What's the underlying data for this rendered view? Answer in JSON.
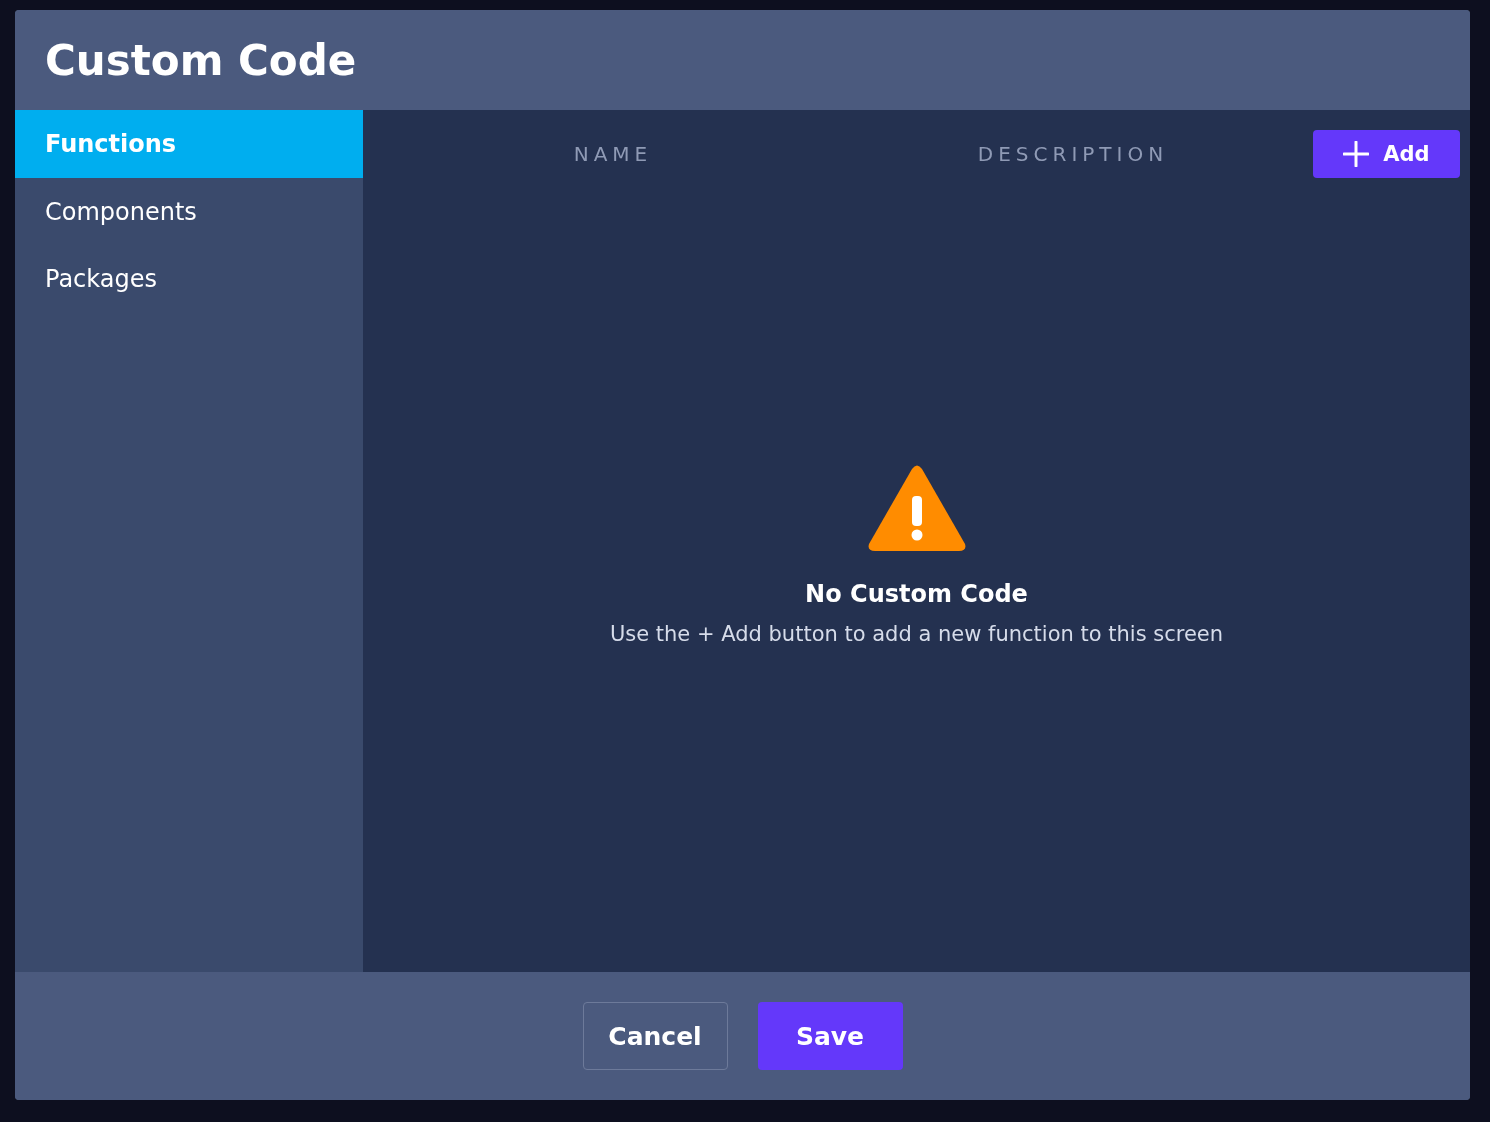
{
  "dialog": {
    "title": "Custom Code"
  },
  "sidebar": {
    "items": [
      {
        "label": "Functions",
        "selected": true
      },
      {
        "label": "Components",
        "selected": false
      },
      {
        "label": "Packages",
        "selected": false
      }
    ]
  },
  "table": {
    "columns": [
      "NAME",
      "DESCRIPTION"
    ]
  },
  "add_button": {
    "label": "Add"
  },
  "empty_state": {
    "title": "No Custom Code",
    "message": "Use the + Add button to add a new function to this screen"
  },
  "buttons": [
    {
      "label": "Cancel",
      "kind": "secondary"
    },
    {
      "label": "Save",
      "kind": "primary"
    }
  ]
}
